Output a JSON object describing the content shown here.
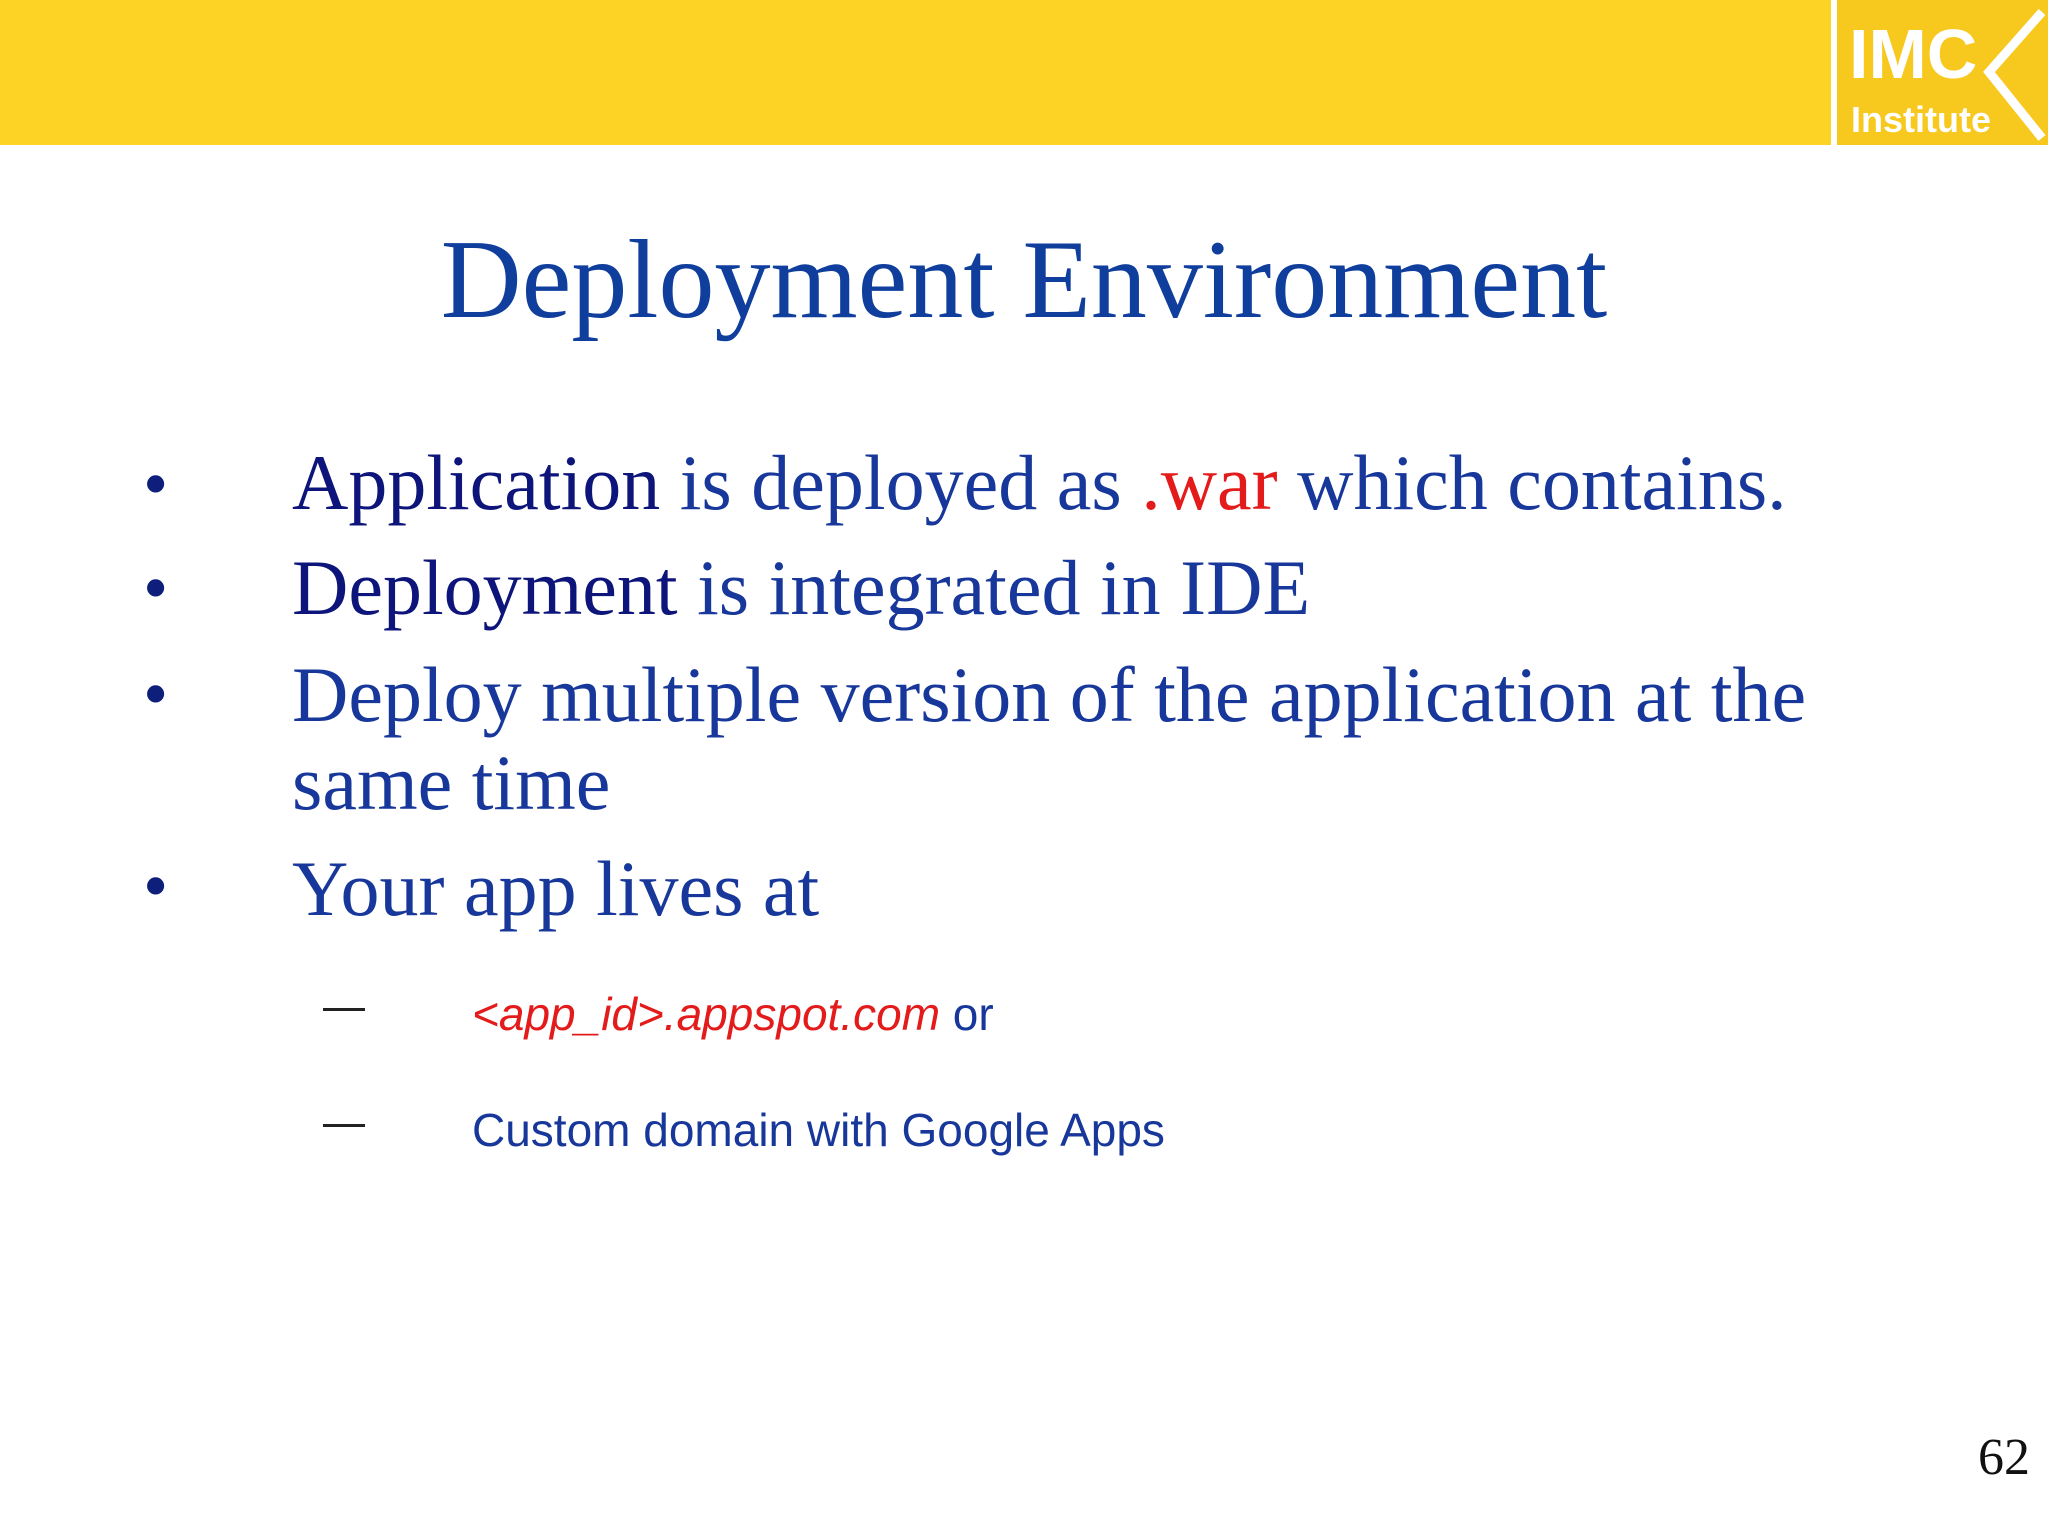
{
  "logo": {
    "line1": "IMC",
    "line2": "Institute"
  },
  "title": "Deployment Environment",
  "bullets": [
    {
      "part1": "Application",
      "part2": " is deployed as ",
      "part3": ".war",
      "part4": " which contains."
    },
    {
      "part1": "Deployment",
      "part2": " is integrated in IDE"
    },
    {
      "line1": "Deploy multiple version of the application at the",
      "line2": "same time"
    },
    {
      "text": "Your app lives at"
    }
  ],
  "sub_bullets": [
    {
      "url": "<app_id>.appspot.com",
      "suffix": " or"
    },
    {
      "text": "Custom domain with Google Apps"
    }
  ],
  "page_number": "62",
  "colors": {
    "header_yellow": "#FDD325",
    "title_blue": "#0F3E9D",
    "text_blue": "#17379A",
    "dark_navy": "#0D157A",
    "highlight_red": "#E31B1B"
  }
}
